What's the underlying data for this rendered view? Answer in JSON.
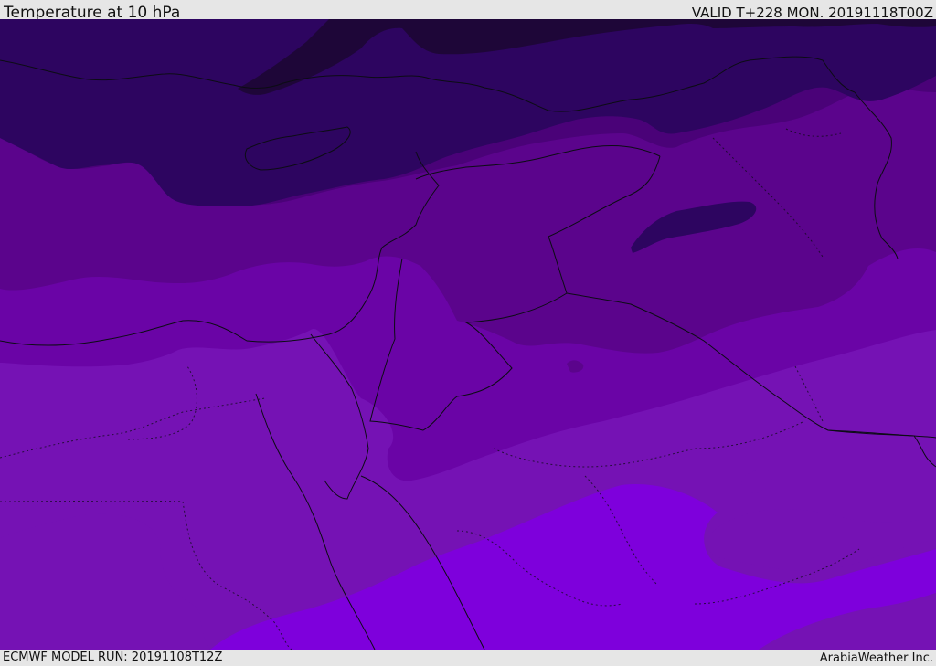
{
  "header": {
    "title": "Temperature at 10 hPa",
    "valid": "VALID T+228 MON. 20191118T00Z"
  },
  "footer": {
    "model_run": "ECMWF MODEL RUN: 20191108T12Z",
    "credit": "ArabiaWeather Inc."
  },
  "map": {
    "colors": {
      "band_darkest": "#1e0638",
      "band_dark": "#2d0560",
      "band_mid_dark": "#4a0278",
      "band_mid": "#5b048c",
      "band_light": "#6a04a6",
      "band_lighter": "#7512b4",
      "band_brightest": "#7e00dc",
      "border_line": "#0c0c14"
    }
  }
}
